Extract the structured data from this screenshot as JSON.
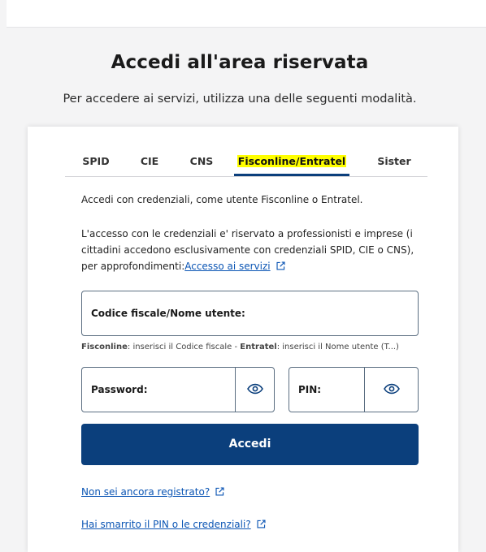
{
  "heading": {
    "title": "Accedi all'area riservata",
    "subtitle": "Per accedere ai servizi, utilizza una delle seguenti modalità."
  },
  "tabs": [
    {
      "label": "SPID",
      "active": false
    },
    {
      "label": "CIE",
      "active": false
    },
    {
      "label": "CNS",
      "active": false
    },
    {
      "label": "Fisconline/Entratel",
      "active": true
    },
    {
      "label": "Sister",
      "active": false
    }
  ],
  "content": {
    "intro": "Accedi con credenziali, come utente Fisconline o Entratel.",
    "notice": "L'accesso con le credenziali e' riservato a professionisti e imprese (i cittadini accedono esclusivamente con credenziali SPID, CIE o CNS), per approfondimenti:",
    "notice_link": "Accesso ai servizi"
  },
  "form": {
    "username_label": "Codice fiscale/Nome utente:",
    "hint_fisconline_label": "Fisconline",
    "hint_fisconline_text": ": inserisci il Codice fiscale - ",
    "hint_entratel_label": "Entratel",
    "hint_entratel_text": ": inserisci il Nome utente (T...)",
    "password_label": "Password:",
    "pin_label": "PIN:",
    "submit_label": "Accedi"
  },
  "links": {
    "register": "Non sei ancora registrato?",
    "lost_pin": "Hai smarrito il PIN o le credenziali?"
  },
  "colors": {
    "primary": "#0b3f7c",
    "link": "#0b55b4",
    "highlight": "#ffff00"
  },
  "icons": {
    "external": "external-link-icon",
    "eye": "eye-icon"
  }
}
